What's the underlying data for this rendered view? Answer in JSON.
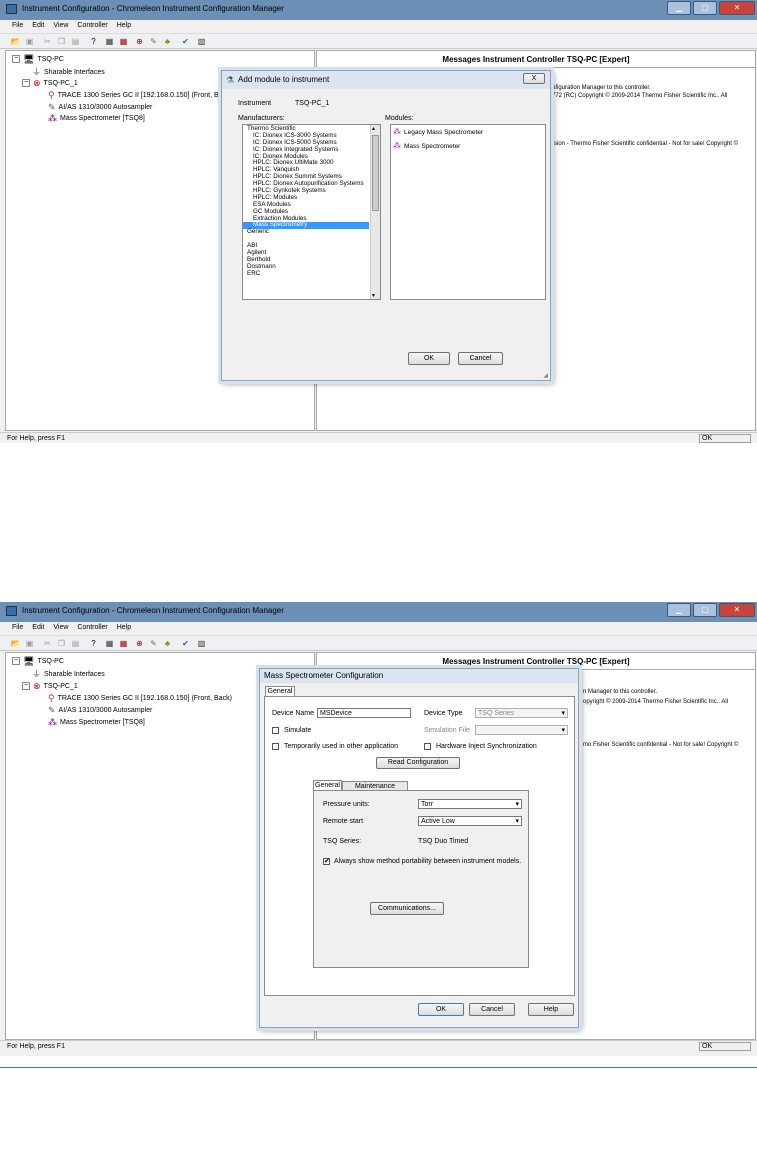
{
  "app": {
    "title": "Instrument Configuration - Chromeleon Instrument Configuration Manager",
    "menu": [
      "File",
      "Edit",
      "View",
      "Controller",
      "Help"
    ],
    "status_help": "For Help, press F1",
    "status_ok": "OK"
  },
  "tree": {
    "root": "TSQ-PC",
    "sharable": "Sharable Interfaces",
    "instrument": "TSQ-PC_1",
    "gc_s1": "TRACE 1300 Series GC II [192.168.0.150] (Front, Ba",
    "gc_s2": "TRACE 1300 Series GC II [192.168.0.150] (Front, Back)",
    "autosampler": "AI/AS 1310/3000 Autosampler",
    "ms": "Mass Spectrometer [TSQ8]"
  },
  "right_pane": {
    "title": "Messages Instrument Controller TSQ-PC [Expert]",
    "s1_line1": "nfiguration Manager to this controller.",
    "s1_line2": "772 (RC) Copyright © 2009-2014 Thermo Fisher Scientific Inc.. All",
    "s1_line3": "rsion - Thermo Fisher Scientific confidential - Not for sale! Copyright ©",
    "s2_line1": "n Manager to this controller.",
    "s2_line2": "opyright © 2009-2014 Thermo Fisher Scientific Inc.. All",
    "s2_line3": "mo Fisher Scientific confidential - Not for sale! Copyright ©"
  },
  "add_module": {
    "title": "Add module to instrument",
    "instrument_label": "Instrument",
    "instrument_value": "TSQ-PC_1",
    "manufacturers_label": "Manufacturers:",
    "modules_label": "Modules:",
    "manufacturers": [
      {
        "label": "Thermo Scientific",
        "indent": false,
        "selected": false
      },
      {
        "label": "IC: Dionex ICS-3000 Systems",
        "indent": true,
        "selected": false
      },
      {
        "label": "IC: Dionex ICS-5000 Systems",
        "indent": true,
        "selected": false
      },
      {
        "label": "IC: Dionex Integrated Systems",
        "indent": true,
        "selected": false
      },
      {
        "label": "IC: Dionex Modules",
        "indent": true,
        "selected": false
      },
      {
        "label": "HPLC: Dionex UltiMate 3000",
        "indent": true,
        "selected": false
      },
      {
        "label": "HPLC: Vanquish",
        "indent": true,
        "selected": false
      },
      {
        "label": "HPLC: Dionex Summit Systems",
        "indent": true,
        "selected": false
      },
      {
        "label": "HPLC: Dionex Autopurification Systems",
        "indent": true,
        "selected": false
      },
      {
        "label": "HPLC: Gynkotek Systems",
        "indent": true,
        "selected": false
      },
      {
        "label": "HPLC: Modules",
        "indent": true,
        "selected": false
      },
      {
        "label": "ESA Modules",
        "indent": true,
        "selected": false
      },
      {
        "label": "GC Modules",
        "indent": true,
        "selected": false
      },
      {
        "label": "Extraction Modules",
        "indent": true,
        "selected": false
      },
      {
        "label": "Mass Spectrometry",
        "indent": true,
        "selected": true
      },
      {
        "label": "Generic",
        "indent": false,
        "selected": false
      },
      {
        "label": "",
        "indent": false,
        "selected": false
      },
      {
        "label": "ABI",
        "indent": false,
        "selected": false
      },
      {
        "label": "Agilent",
        "indent": false,
        "selected": false
      },
      {
        "label": "Berthold",
        "indent": false,
        "selected": false
      },
      {
        "label": "Dostmann",
        "indent": false,
        "selected": false
      },
      {
        "label": "ERC",
        "indent": false,
        "selected": false
      }
    ],
    "modules": [
      "Legacy Mass Spectrometer",
      "Mass Spectrometer"
    ],
    "ok": "OK",
    "cancel": "Cancel",
    "close": "X"
  },
  "ms_config": {
    "title": "Mass Spectrometer Configuration",
    "tab_general": "General",
    "device_name_label": "Device Name",
    "device_name_value": "MSDevice",
    "device_type_label": "Device Type",
    "device_type_value": "TSQ Series",
    "simulate_label": "Simulate",
    "simulation_file_label": "Simulation File",
    "simulation_file_value": "",
    "temp_used_label": "Temporarily used in other application",
    "hw_inject_label": "Hardware Inject Synchronization",
    "read_config": "Read Configuration",
    "inner_tab_general": "General",
    "inner_tab_maint": "Maintenance Intervals",
    "pressure_label": "Pressure units:",
    "pressure_value": "Torr",
    "remote_label": "Remote start",
    "remote_value": "Active Low",
    "series_label": "TSQ Series:",
    "series_value": "TSQ Duo Timed",
    "portability_label": "Always show method portability between instrument models.",
    "portability_checked": true,
    "communications": "Communications...",
    "ok": "OK",
    "cancel": "Cancel",
    "help": "Help"
  }
}
